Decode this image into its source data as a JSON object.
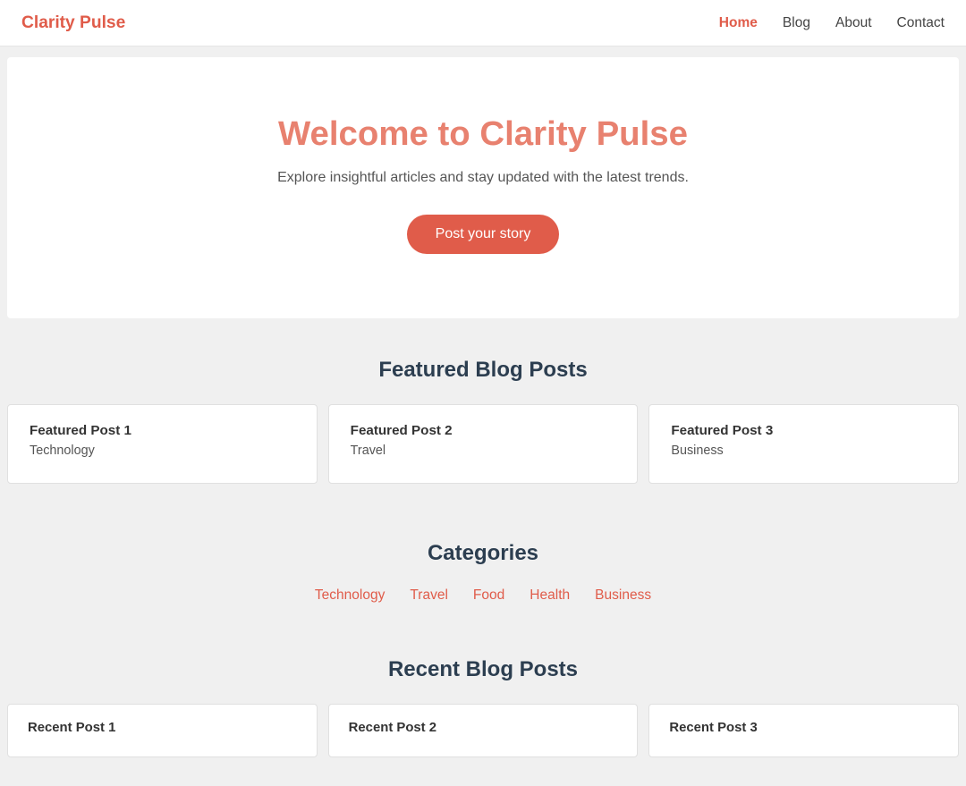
{
  "nav": {
    "logo": "Clarity Pulse",
    "links": [
      {
        "label": "Home",
        "active": true
      },
      {
        "label": "Blog",
        "active": false
      },
      {
        "label": "About",
        "active": false
      },
      {
        "label": "Contact",
        "active": false
      }
    ]
  },
  "hero": {
    "title": "Welcome to Clarity Pulse",
    "subtitle": "Explore insightful articles and stay updated with the latest trends.",
    "button_label": "Post your story"
  },
  "featured": {
    "section_title": "Featured Blog Posts",
    "posts": [
      {
        "title": "Featured Post 1",
        "category": "Technology"
      },
      {
        "title": "Featured Post 2",
        "category": "Travel"
      },
      {
        "title": "Featured Post 3",
        "category": "Business"
      }
    ]
  },
  "categories": {
    "section_title": "Categories",
    "items": [
      {
        "label": "Technology"
      },
      {
        "label": "Travel"
      },
      {
        "label": "Food"
      },
      {
        "label": "Health"
      },
      {
        "label": "Business"
      }
    ]
  },
  "recent": {
    "section_title": "Recent Blog Posts",
    "posts": [
      {
        "title": "Recent Post 1"
      },
      {
        "title": "Recent Post 2"
      },
      {
        "title": "Recent Post 3"
      }
    ]
  }
}
